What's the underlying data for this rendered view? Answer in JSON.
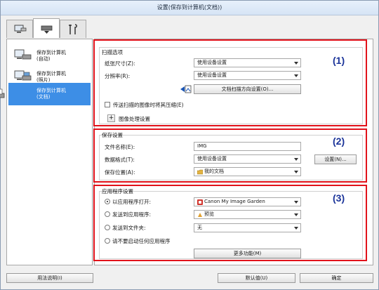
{
  "window": {
    "title": "设置(保存到计算机(文档))"
  },
  "tabs": [
    {
      "icon": "scan-from-computer-icon"
    },
    {
      "icon": "scan-from-panel-icon"
    },
    {
      "icon": "tools-icon"
    }
  ],
  "sidebar": {
    "items": [
      {
        "line1": "保存到计算机",
        "line2": "(自动)",
        "icon": "scanner-auto-icon"
      },
      {
        "line1": "保存到计算机",
        "line2": "(照片)",
        "icon": "scanner-photo-icon"
      },
      {
        "line1": "保存到计算机",
        "line2": "(文档)",
        "icon": "scanner-document-icon",
        "selected": true
      }
    ]
  },
  "scan_options": {
    "title": "扫描选项",
    "paper_size_label": "纸张尺寸(Z):",
    "paper_size_value": "使用设备设置",
    "resolution_label": "分辨率(R):",
    "resolution_value": "使用设备设置",
    "orientation_button": "文档扫描方向设置(O)...",
    "compress_label": "传送扫描的图像时将其压缩(E)",
    "image_processing_label": "图像处理设置",
    "callout": "(1)"
  },
  "save_settings": {
    "title": "保存设置",
    "filename_label": "文件名称(E):",
    "filename_value": "IMG",
    "format_label": "数据格式(T):",
    "format_value": "使用设备设置",
    "settings_button": "设置(N)...",
    "location_label": "保存位置(A):",
    "location_value": "我的文档",
    "callout": "(2)"
  },
  "app_settings": {
    "title": "应用程序设置",
    "open_with_label": "以应用程序打开:",
    "open_with_value": "Canon My Image Garden",
    "send_app_label": "发送到应用程序:",
    "send_app_value": "预览",
    "send_folder_label": "发送到文件夹:",
    "send_folder_value": "无",
    "no_app_label": "请不要启动任何应用程序",
    "more_button": "更多功能(M)",
    "callout": "(3)"
  },
  "footer": {
    "help_button": "用法说明(I)",
    "defaults_button": "默认值(U)",
    "ok_button": "确定"
  },
  "colors": {
    "accent_red": "#e1121a",
    "selection_blue": "#3d8ee6",
    "callout_blue": "#1a3399"
  }
}
